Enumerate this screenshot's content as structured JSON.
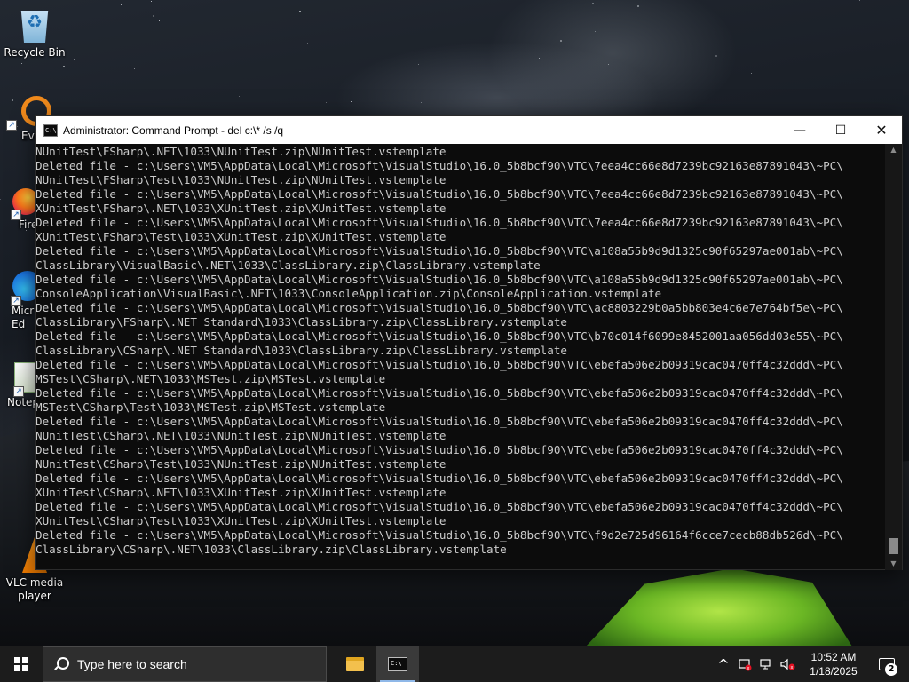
{
  "desktop": {
    "icons": [
      {
        "label": "Recycle Bin",
        "icon": "recycle-bin-icon"
      },
      {
        "label": "Every",
        "icon": "everything-icon"
      },
      {
        "label": "Fire",
        "icon": "firefox-icon"
      },
      {
        "label": "Micr\nEd",
        "icon": "edge-icon"
      },
      {
        "label": "Notep",
        "icon": "notepad-icon"
      },
      {
        "label": "VLC media\nplayer",
        "icon": "vlc-icon"
      }
    ]
  },
  "window": {
    "title": "Administrator: Command Prompt - del  c:\\* /s /q",
    "buttons": {
      "minimize": "—",
      "maximize": "☐",
      "close": "✕"
    },
    "lines": [
      "NUnitTest\\FSharp\\.NET\\1033\\NUnitTest.zip\\NUnitTest.vstemplate",
      "Deleted file - c:\\Users\\VM5\\AppData\\Local\\Microsoft\\VisualStudio\\16.0_5b8bcf90\\VTC\\7eea4cc66e8d7239bc92163e87891043\\~PC\\",
      "NUnitTest\\FSharp\\Test\\1033\\NUnitTest.zip\\NUnitTest.vstemplate",
      "Deleted file - c:\\Users\\VM5\\AppData\\Local\\Microsoft\\VisualStudio\\16.0_5b8bcf90\\VTC\\7eea4cc66e8d7239bc92163e87891043\\~PC\\",
      "XUnitTest\\FSharp\\.NET\\1033\\XUnitTest.zip\\XUnitTest.vstemplate",
      "Deleted file - c:\\Users\\VM5\\AppData\\Local\\Microsoft\\VisualStudio\\16.0_5b8bcf90\\VTC\\7eea4cc66e8d7239bc92163e87891043\\~PC\\",
      "XUnitTest\\FSharp\\Test\\1033\\XUnitTest.zip\\XUnitTest.vstemplate",
      "Deleted file - c:\\Users\\VM5\\AppData\\Local\\Microsoft\\VisualStudio\\16.0_5b8bcf90\\VTC\\a108a55b9d9d1325c90f65297ae001ab\\~PC\\",
      "ClassLibrary\\VisualBasic\\.NET\\1033\\ClassLibrary.zip\\ClassLibrary.vstemplate",
      "Deleted file - c:\\Users\\VM5\\AppData\\Local\\Microsoft\\VisualStudio\\16.0_5b8bcf90\\VTC\\a108a55b9d9d1325c90f65297ae001ab\\~PC\\",
      "ConsoleApplication\\VisualBasic\\.NET\\1033\\ConsoleApplication.zip\\ConsoleApplication.vstemplate",
      "Deleted file - c:\\Users\\VM5\\AppData\\Local\\Microsoft\\VisualStudio\\16.0_5b8bcf90\\VTC\\ac8803229b0a5bb803e4c6e7e764bf5e\\~PC\\",
      "ClassLibrary\\FSharp\\.NET Standard\\1033\\ClassLibrary.zip\\ClassLibrary.vstemplate",
      "Deleted file - c:\\Users\\VM5\\AppData\\Local\\Microsoft\\VisualStudio\\16.0_5b8bcf90\\VTC\\b70c014f6099e8452001aa056dd03e55\\~PC\\",
      "ClassLibrary\\CSharp\\.NET Standard\\1033\\ClassLibrary.zip\\ClassLibrary.vstemplate",
      "Deleted file - c:\\Users\\VM5\\AppData\\Local\\Microsoft\\VisualStudio\\16.0_5b8bcf90\\VTC\\ebefa506e2b09319cac0470ff4c32ddd\\~PC\\",
      "MSTest\\CSharp\\.NET\\1033\\MSTest.zip\\MSTest.vstemplate",
      "Deleted file - c:\\Users\\VM5\\AppData\\Local\\Microsoft\\VisualStudio\\16.0_5b8bcf90\\VTC\\ebefa506e2b09319cac0470ff4c32ddd\\~PC\\",
      "MSTest\\CSharp\\Test\\1033\\MSTest.zip\\MSTest.vstemplate",
      "Deleted file - c:\\Users\\VM5\\AppData\\Local\\Microsoft\\VisualStudio\\16.0_5b8bcf90\\VTC\\ebefa506e2b09319cac0470ff4c32ddd\\~PC\\",
      "NUnitTest\\CSharp\\.NET\\1033\\NUnitTest.zip\\NUnitTest.vstemplate",
      "Deleted file - c:\\Users\\VM5\\AppData\\Local\\Microsoft\\VisualStudio\\16.0_5b8bcf90\\VTC\\ebefa506e2b09319cac0470ff4c32ddd\\~PC\\",
      "NUnitTest\\CSharp\\Test\\1033\\NUnitTest.zip\\NUnitTest.vstemplate",
      "Deleted file - c:\\Users\\VM5\\AppData\\Local\\Microsoft\\VisualStudio\\16.0_5b8bcf90\\VTC\\ebefa506e2b09319cac0470ff4c32ddd\\~PC\\",
      "XUnitTest\\CSharp\\.NET\\1033\\XUnitTest.zip\\XUnitTest.vstemplate",
      "Deleted file - c:\\Users\\VM5\\AppData\\Local\\Microsoft\\VisualStudio\\16.0_5b8bcf90\\VTC\\ebefa506e2b09319cac0470ff4c32ddd\\~PC\\",
      "XUnitTest\\CSharp\\Test\\1033\\XUnitTest.zip\\XUnitTest.vstemplate",
      "Deleted file - c:\\Users\\VM5\\AppData\\Local\\Microsoft\\VisualStudio\\16.0_5b8bcf90\\VTC\\f9d2e725d96164f6cce7cecb88db526d\\~PC\\",
      "ClassLibrary\\CSharp\\.NET\\1033\\ClassLibrary.zip\\ClassLibrary.vstemplate"
    ]
  },
  "taskbar": {
    "search_placeholder": "Type here to search",
    "apps": [
      {
        "name": "file-explorer",
        "icon": "folder-icon",
        "active": false
      },
      {
        "name": "command-prompt",
        "icon": "cmd-icon",
        "active": true
      }
    ],
    "tray": {
      "chevron": "^",
      "time": "10:52 AM",
      "date": "1/18/2025",
      "notification_count": "2"
    }
  },
  "colors": {
    "console_bg": "#0c0c0c",
    "console_text": "#cccccc",
    "taskbar_bg": "#1c1c1c",
    "titlebar_bg": "#ffffff"
  }
}
